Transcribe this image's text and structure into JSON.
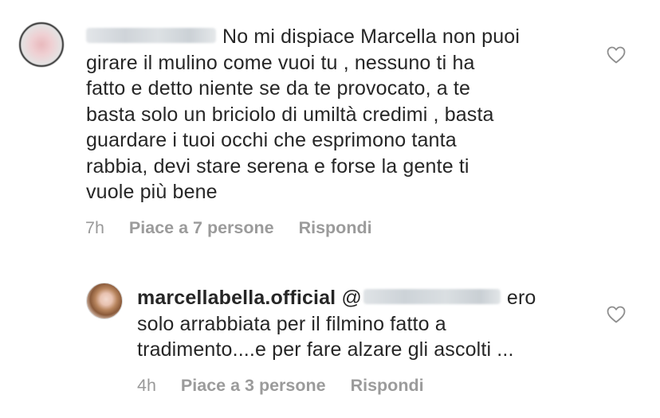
{
  "comments": [
    {
      "username": "",
      "text": "No mi dispiace Marcella non puoi girare il mulino come vuoi tu , nessuno ti ha fatto e detto niente se da te provocato, a te basta solo un briciolo di umiltà credimi , basta guardare i tuoi occhi che esprimono tanta rabbia, devi stare serena e forse la gente ti vuole più bene",
      "lines": [
        "No mi dispiace Marcella non puoi",
        "girare il mulino come vuoi tu , nessuno ti ha",
        "fatto e detto niente se da te provocato, a te",
        "basta solo un briciolo di umiltà credimi , basta",
        "guardare i tuoi occhi che esprimono tanta",
        "rabbia, devi stare serena e forse la gente ti",
        "vuole più bene"
      ],
      "time": "7h",
      "likes": "Piace a 7 persone",
      "reply": "Rispondi",
      "avatar_icon": "blurred-avatar",
      "like_icon": "heart-outline-icon"
    },
    {
      "username": "marcellabella.official",
      "mention_prefix": "@",
      "lines": [
        "ero",
        "solo arrabbiata per il filmino fatto a",
        "tradimento....e per fare alzare gli ascolti ..."
      ],
      "time": "4h",
      "likes": "Piace a 3 persone",
      "reply": "Rispondi",
      "avatar_icon": "profile-photo-avatar",
      "like_icon": "heart-outline-icon"
    }
  ],
  "colors": {
    "text": "#262626",
    "meta": "#999999",
    "background": "#ffffff"
  }
}
